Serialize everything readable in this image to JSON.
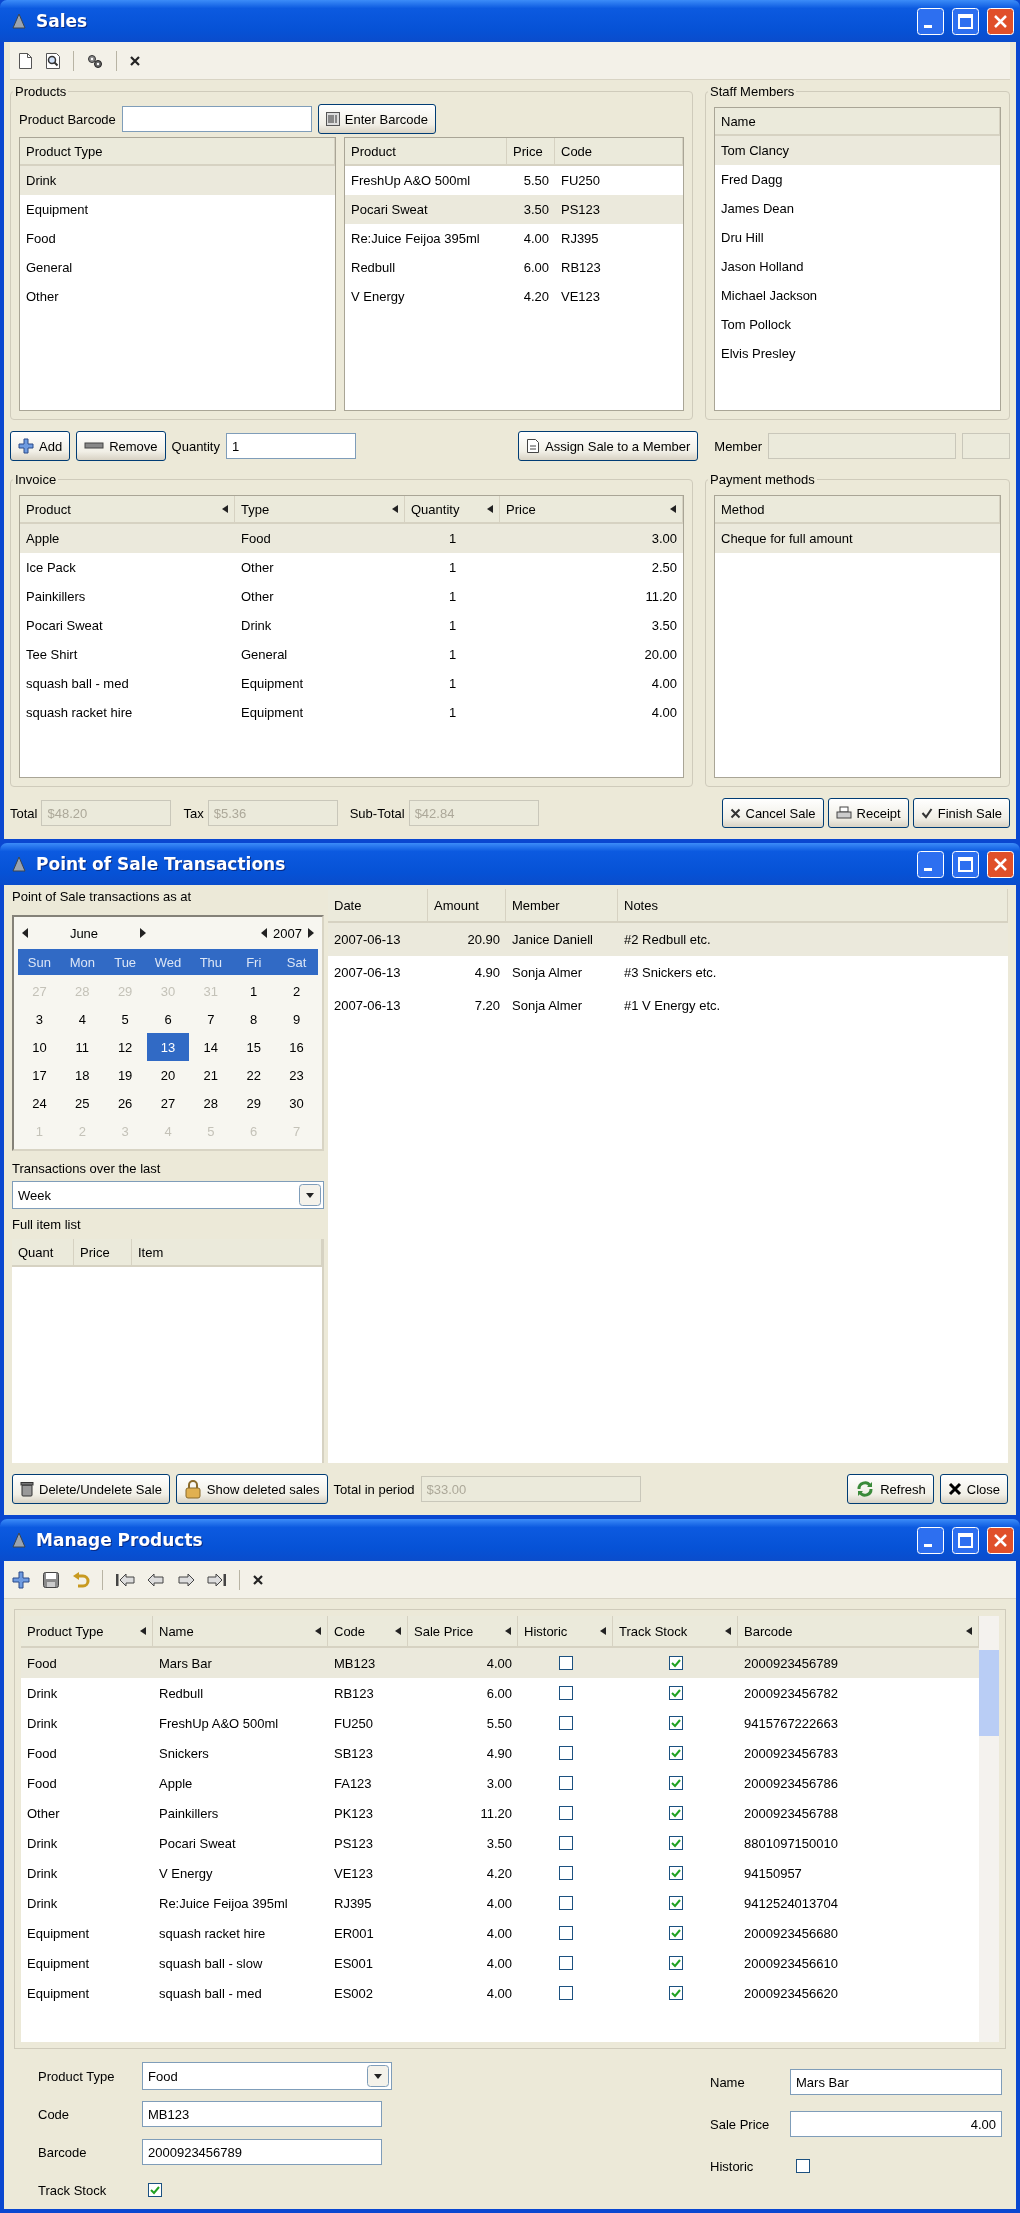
{
  "sales": {
    "title": "Sales",
    "products": {
      "label": "Products",
      "barcode_label": "Product Barcode",
      "enter_barcode_button": "Enter Barcode",
      "types": {
        "column": "Product Type",
        "items": [
          {
            "label": "Drink",
            "selected": true
          },
          {
            "label": "Equipment",
            "selected": false
          },
          {
            "label": "Food",
            "selected": false
          },
          {
            "label": "General",
            "selected": false
          },
          {
            "label": "Other",
            "selected": false
          }
        ]
      },
      "list": {
        "columns": [
          "Product",
          "Price",
          "Code"
        ],
        "rows": [
          {
            "cells": [
              "FreshUp A&O 500ml",
              "5.50",
              "FU250"
            ],
            "selected": false
          },
          {
            "cells": [
              "Pocari Sweat",
              "3.50",
              "PS123"
            ],
            "selected": true
          },
          {
            "cells": [
              "Re:Juice Feijoa 395ml",
              "4.00",
              "RJ395"
            ],
            "selected": false
          },
          {
            "cells": [
              "Redbull",
              "6.00",
              "RB123"
            ],
            "selected": false
          },
          {
            "cells": [
              "V Energy",
              "4.20",
              "VE123"
            ],
            "selected": false
          }
        ]
      }
    },
    "staff": {
      "label": "Staff Members",
      "column": "Name",
      "items": [
        {
          "label": "Tom Clancy",
          "selected": true
        },
        {
          "label": "Fred Dagg",
          "selected": false
        },
        {
          "label": "James Dean",
          "selected": false
        },
        {
          "label": "Dru Hill",
          "selected": false
        },
        {
          "label": "Jason Holland",
          "selected": false
        },
        {
          "label": "Michael Jackson",
          "selected": false
        },
        {
          "label": "Tom Pollock",
          "selected": false
        },
        {
          "label": "Elvis Presley",
          "selected": false
        }
      ]
    },
    "actions": {
      "add_button": "Add",
      "remove_button": "Remove",
      "quantity_label": "Quantity",
      "quantity_value": "1",
      "assign_button": "Assign Sale to a Member",
      "member_label": "Member"
    },
    "invoice": {
      "label": "Invoice",
      "columns": [
        "Product",
        "Type",
        "Quantity",
        "Price"
      ],
      "rows": [
        {
          "cells": [
            "Apple",
            "Food",
            "1",
            "3.00"
          ],
          "selected": true
        },
        {
          "cells": [
            "Ice Pack",
            "Other",
            "1",
            "2.50"
          ],
          "selected": false
        },
        {
          "cells": [
            "Painkillers",
            "Other",
            "1",
            "11.20"
          ],
          "selected": false
        },
        {
          "cells": [
            "Pocari Sweat",
            "Drink",
            "1",
            "3.50"
          ],
          "selected": false
        },
        {
          "cells": [
            "Tee Shirt",
            "General",
            "1",
            "20.00"
          ],
          "selected": false
        },
        {
          "cells": [
            "squash ball - med",
            "Equipment",
            "1",
            "4.00"
          ],
          "selected": false
        },
        {
          "cells": [
            "squash racket hire",
            "Equipment",
            "1",
            "4.00"
          ],
          "selected": false
        }
      ]
    },
    "payment": {
      "label": "Payment methods",
      "column": "Method",
      "items": [
        {
          "label": "Cheque for full amount",
          "selected": true
        }
      ]
    },
    "totals": [
      {
        "label": "Total",
        "value": "$48.20"
      },
      {
        "label": "Tax",
        "value": "$5.36"
      },
      {
        "label": "Sub-Total",
        "value": "$42.84"
      }
    ],
    "buttons": [
      {
        "label": "Cancel Sale",
        "kind": "cancel"
      },
      {
        "label": "Receipt",
        "kind": "print"
      },
      {
        "label": "Finish Sale",
        "kind": "finish"
      }
    ]
  },
  "pos": {
    "title": "Point of Sale Transactions",
    "as_at_label": "Point of Sale transactions as at",
    "calendar": {
      "month": "June",
      "year": "2007",
      "weekdays": [
        "Sun",
        "Mon",
        "Tue",
        "Wed",
        "Thu",
        "Fri",
        "Sat"
      ],
      "days": [
        {
          "label": "27",
          "muted": true,
          "selected": false
        },
        {
          "label": "28",
          "muted": true,
          "selected": false
        },
        {
          "label": "29",
          "muted": true,
          "selected": false
        },
        {
          "label": "30",
          "muted": true,
          "selected": false
        },
        {
          "label": "31",
          "muted": true,
          "selected": false
        },
        {
          "label": "1",
          "muted": false,
          "selected": false
        },
        {
          "label": "2",
          "muted": false,
          "selected": false
        },
        {
          "label": "3",
          "muted": false,
          "selected": false
        },
        {
          "label": "4",
          "muted": false,
          "selected": false
        },
        {
          "label": "5",
          "muted": false,
          "selected": false
        },
        {
          "label": "6",
          "muted": false,
          "selected": false
        },
        {
          "label": "7",
          "muted": false,
          "selected": false
        },
        {
          "label": "8",
          "muted": false,
          "selected": false
        },
        {
          "label": "9",
          "muted": false,
          "selected": false
        },
        {
          "label": "10",
          "muted": false,
          "selected": false
        },
        {
          "label": "11",
          "muted": false,
          "selected": false
        },
        {
          "label": "12",
          "muted": false,
          "selected": false
        },
        {
          "label": "13",
          "muted": false,
          "selected": true
        },
        {
          "label": "14",
          "muted": false,
          "selected": false
        },
        {
          "label": "15",
          "muted": false,
          "selected": false
        },
        {
          "label": "16",
          "muted": false,
          "selected": false
        },
        {
          "label": "17",
          "muted": false,
          "selected": false
        },
        {
          "label": "18",
          "muted": false,
          "selected": false
        },
        {
          "label": "19",
          "muted": false,
          "selected": false
        },
        {
          "label": "20",
          "muted": false,
          "selected": false
        },
        {
          "label": "21",
          "muted": false,
          "selected": false
        },
        {
          "label": "22",
          "muted": false,
          "selected": false
        },
        {
          "label": "23",
          "muted": false,
          "selected": false
        },
        {
          "label": "24",
          "muted": false,
          "selected": false
        },
        {
          "label": "25",
          "muted": false,
          "selected": false
        },
        {
          "label": "26",
          "muted": false,
          "selected": false
        },
        {
          "label": "27",
          "muted": false,
          "selected": false
        },
        {
          "label": "28",
          "muted": false,
          "selected": false
        },
        {
          "label": "29",
          "muted": false,
          "selected": false
        },
        {
          "label": "30",
          "muted": false,
          "selected": false
        },
        {
          "label": "1",
          "muted": true,
          "selected": false
        },
        {
          "label": "2",
          "muted": true,
          "selected": false
        },
        {
          "label": "3",
          "muted": true,
          "selected": false
        },
        {
          "label": "4",
          "muted": true,
          "selected": false
        },
        {
          "label": "5",
          "muted": true,
          "selected": false
        },
        {
          "label": "6",
          "muted": true,
          "selected": false
        },
        {
          "label": "7",
          "muted": true,
          "selected": false
        }
      ]
    },
    "period_label": "Transactions over the last",
    "period_value": "Week",
    "items_label": "Full item list",
    "item_columns": [
      "Quant",
      "Price",
      "Item"
    ],
    "transactions": {
      "columns": [
        "Date",
        "Amount",
        "Member",
        "Notes"
      ],
      "rows": [
        {
          "cells": [
            "2007-06-13",
            "20.90",
            "Janice Daniell",
            "#2 Redbull etc."
          ],
          "selected": true
        },
        {
          "cells": [
            "2007-06-13",
            "4.90",
            "Sonja Almer",
            "#3 Snickers etc."
          ],
          "selected": false
        },
        {
          "cells": [
            "2007-06-13",
            "7.20",
            "Sonja Almer",
            "#1 V Energy etc."
          ],
          "selected": false
        }
      ]
    },
    "delete_button": "Delete/Undelete Sale",
    "show_deleted_button": "Show deleted sales",
    "total_label": "Total in period",
    "total_value": "$33.00",
    "refresh_button": "Refresh",
    "close_button": "Close"
  },
  "products_manager": {
    "title": "Manage Products",
    "table": {
      "columns": [
        "Product Type",
        "Name",
        "Code",
        "Sale Price",
        "Historic",
        "Track Stock",
        "Barcode"
      ],
      "rows": [
        {
          "type": "Food",
          "name": "Mars Bar",
          "code": "MB123",
          "price": "4.00",
          "historic": false,
          "track_stock": true,
          "barcode": "2000923456789",
          "selected": true
        },
        {
          "type": "Drink",
          "name": "Redbull",
          "code": "RB123",
          "price": "6.00",
          "historic": false,
          "track_stock": true,
          "barcode": "2000923456782",
          "selected": false
        },
        {
          "type": "Drink",
          "name": "FreshUp A&O 500ml",
          "code": "FU250",
          "price": "5.50",
          "historic": false,
          "track_stock": true,
          "barcode": "9415767222663",
          "selected": false
        },
        {
          "type": "Food",
          "name": "Snickers",
          "code": "SB123",
          "price": "4.90",
          "historic": false,
          "track_stock": true,
          "barcode": "2000923456783",
          "selected": false
        },
        {
          "type": "Food",
          "name": "Apple",
          "code": "FA123",
          "price": "3.00",
          "historic": false,
          "track_stock": true,
          "barcode": "2000923456786",
          "selected": false
        },
        {
          "type": "Other",
          "name": "Painkillers",
          "code": "PK123",
          "price": "11.20",
          "historic": false,
          "track_stock": true,
          "barcode": "2000923456788",
          "selected": false
        },
        {
          "type": "Drink",
          "name": "Pocari Sweat",
          "code": "PS123",
          "price": "3.50",
          "historic": false,
          "track_stock": true,
          "barcode": "8801097150010",
          "selected": false
        },
        {
          "type": "Drink",
          "name": "V Energy",
          "code": "VE123",
          "price": "4.20",
          "historic": false,
          "track_stock": true,
          "barcode": "94150957",
          "selected": false
        },
        {
          "type": "Drink",
          "name": "Re:Juice Feijoa 395ml",
          "code": "RJ395",
          "price": "4.00",
          "historic": false,
          "track_stock": true,
          "barcode": "9412524013704",
          "selected": false
        },
        {
          "type": "Equipment",
          "name": "squash racket hire",
          "code": "ER001",
          "price": "4.00",
          "historic": false,
          "track_stock": true,
          "barcode": "2000923456680",
          "selected": false
        },
        {
          "type": "Equipment",
          "name": "squash ball - slow",
          "code": "ES001",
          "price": "4.00",
          "historic": false,
          "track_stock": true,
          "barcode": "2000923456610",
          "selected": false
        },
        {
          "type": "Equipment",
          "name": "squash ball - med",
          "code": "ES002",
          "price": "4.00",
          "historic": false,
          "track_stock": true,
          "barcode": "2000923456620",
          "selected": false
        }
      ]
    },
    "form": {
      "product_type_label": "Product Type",
      "product_type_value": "Food",
      "code_label": "Code",
      "code_value": "MB123",
      "barcode_label": "Barcode",
      "barcode_value": "2000923456789",
      "track_stock_label": "Track Stock",
      "track_stock": true,
      "name_label": "Name",
      "name_value": "Mars Bar",
      "sale_price_label": "Sale Price",
      "sale_price_value": "4.00",
      "historic_label": "Historic",
      "historic": false
    }
  }
}
